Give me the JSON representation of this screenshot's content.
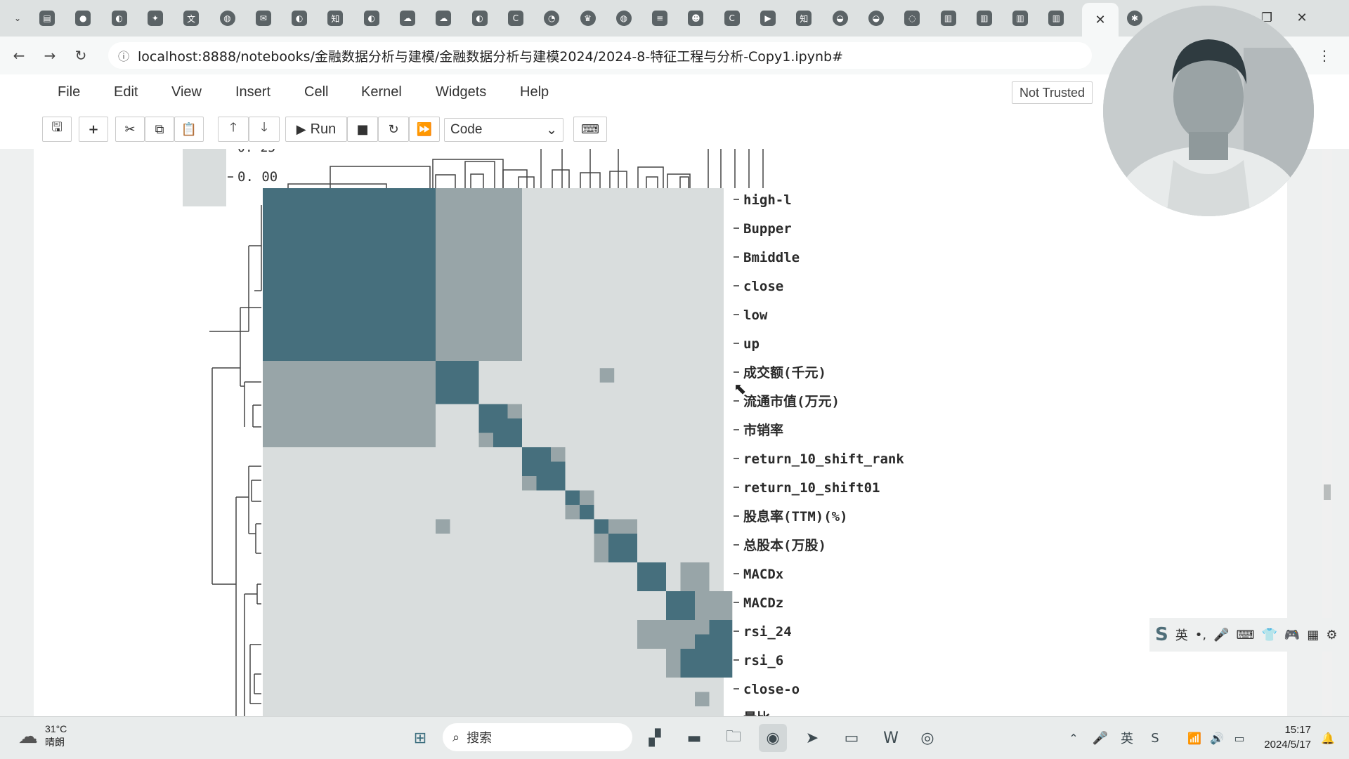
{
  "browser": {
    "url": "localhost:8888/notebooks/金融数据分析与建模/金融数据分析与建模2024/2024-8-特征工程与分析-Copy1.ipynb#",
    "tab_icons": [
      "calendar-icon",
      "record-icon",
      "github-icon",
      "ai-icon",
      "translate-icon",
      "globe-icon",
      "mail-icon",
      "github-icon",
      "zhihu-icon",
      "github-icon",
      "cloud-icon",
      "cloud-icon",
      "github-icon",
      "c-icon",
      "chat-icon",
      "crown-icon",
      "globe-icon",
      "stack-icon",
      "avatar-icon",
      "c-icon",
      "video-icon",
      "zhihu-icon",
      "bowl-icon",
      "bowl-icon",
      "loading-icon",
      "book-icon",
      "book-icon",
      "book-icon",
      "book-icon"
    ],
    "active_tab_icon": "close-icon"
  },
  "jupyter": {
    "menu": [
      "File",
      "Edit",
      "View",
      "Insert",
      "Cell",
      "Kernel",
      "Widgets",
      "Help"
    ],
    "trusted": "Not Trusted",
    "toolbar": {
      "run_label": "Run",
      "cell_type": "Code"
    }
  },
  "chart_data": {
    "type": "heatmap",
    "colorbar_tick": "0. 00",
    "rows": [
      "high-l",
      "Bupper",
      "Bmiddle",
      "close",
      "low",
      "up",
      "成交额(千元)",
      "流通市值(万元)",
      "市销率",
      "return_10_shift_rank",
      "return_10_shift01",
      "股息率(TTM)(%)",
      "总股本(万股)",
      "MACDx",
      "MACDz",
      "rsi_24",
      "rsi_6",
      "close-o",
      "量比"
    ],
    "levels": {
      "low": "#d9dddd",
      "mid": "#98a5a8",
      "high": "#466f7d"
    }
  },
  "ime": {
    "lang": "英"
  },
  "taskbar": {
    "weather_temp": "31°C",
    "weather_desc": "晴朗",
    "search_placeholder": "搜索",
    "time": "15:17",
    "date": "2024/5/17"
  }
}
